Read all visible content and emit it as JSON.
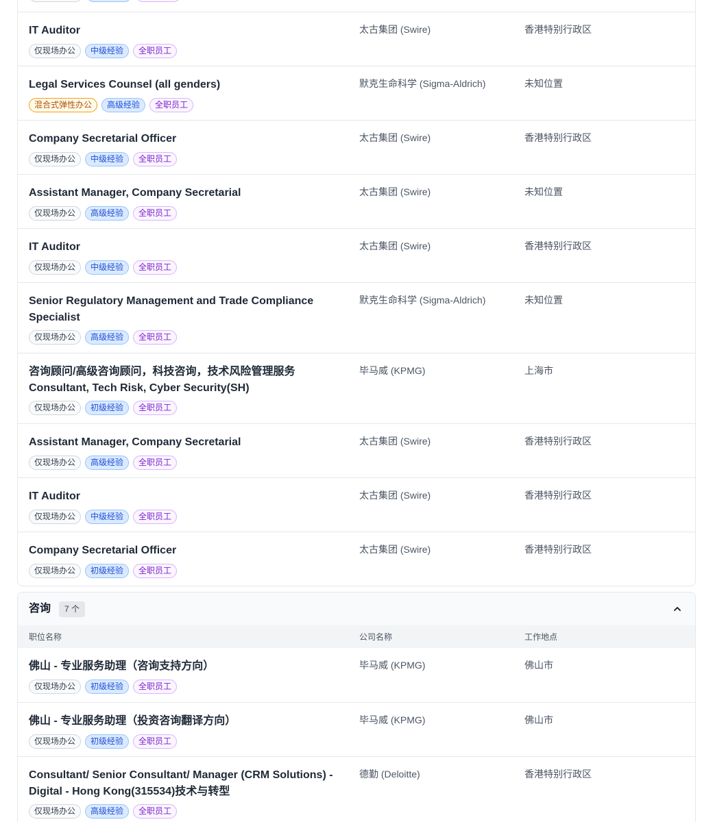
{
  "tag_colors": {
    "gray": "#374151",
    "orange": "#b45309",
    "blue": "#1d4ed8",
    "purple": "#7e22ce"
  },
  "top_group": {
    "rows": [
      {
        "title": "IT Auditor",
        "company": "太古集团 (Swire)",
        "location": "香港特别行政区",
        "tags": [
          {
            "text": "仅现场办公",
            "color": "gray"
          },
          {
            "text": "中级经验",
            "color": "blue"
          },
          {
            "text": "全职员工",
            "color": "purple"
          }
        ]
      },
      {
        "title": "Legal Services Counsel (all genders)",
        "company": "默克生命科学 (Sigma-Aldrich)",
        "location": "未知位置",
        "tags": [
          {
            "text": "混合式弹性办公",
            "color": "orange"
          },
          {
            "text": "高级经验",
            "color": "blue"
          },
          {
            "text": "全职员工",
            "color": "purple"
          }
        ]
      },
      {
        "title": "Company Secretarial Officer",
        "company": "太古集团 (Swire)",
        "location": "香港特别行政区",
        "tags": [
          {
            "text": "仅现场办公",
            "color": "gray"
          },
          {
            "text": "中级经验",
            "color": "blue"
          },
          {
            "text": "全职员工",
            "color": "purple"
          }
        ]
      },
      {
        "title": "Assistant Manager, Company Secretarial",
        "company": "太古集团 (Swire)",
        "location": "未知位置",
        "tags": [
          {
            "text": "仅现场办公",
            "color": "gray"
          },
          {
            "text": "高级经验",
            "color": "blue"
          },
          {
            "text": "全职员工",
            "color": "purple"
          }
        ]
      },
      {
        "title": "IT Auditor",
        "company": "太古集团 (Swire)",
        "location": "香港特别行政区",
        "tags": [
          {
            "text": "仅现场办公",
            "color": "gray"
          },
          {
            "text": "中级经验",
            "color": "blue"
          },
          {
            "text": "全职员工",
            "color": "purple"
          }
        ]
      },
      {
        "title": "Senior Regulatory Management and Trade Compliance Specialist",
        "company": "默克生命科学 (Sigma-Aldrich)",
        "location": "未知位置",
        "tags": [
          {
            "text": "仅现场办公",
            "color": "gray"
          },
          {
            "text": "高级经验",
            "color": "blue"
          },
          {
            "text": "全职员工",
            "color": "purple"
          }
        ]
      },
      {
        "title": "咨询顾问/高级咨询顾问，科技咨询，技术风险管理服务 Consultant, Tech Risk, Cyber Security(SH)",
        "company": "毕马威 (KPMG)",
        "location": "上海市",
        "tags": [
          {
            "text": "仅现场办公",
            "color": "gray"
          },
          {
            "text": "初级经验",
            "color": "blue"
          },
          {
            "text": "全职员工",
            "color": "purple"
          }
        ]
      },
      {
        "title": "Assistant Manager, Company Secretarial",
        "company": "太古集团 (Swire)",
        "location": "香港特别行政区",
        "tags": [
          {
            "text": "仅现场办公",
            "color": "gray"
          },
          {
            "text": "高级经验",
            "color": "blue"
          },
          {
            "text": "全职员工",
            "color": "purple"
          }
        ]
      },
      {
        "title": "IT Auditor",
        "company": "太古集团 (Swire)",
        "location": "香港特别行政区",
        "tags": [
          {
            "text": "仅现场办公",
            "color": "gray"
          },
          {
            "text": "中级经验",
            "color": "blue"
          },
          {
            "text": "全职员工",
            "color": "purple"
          }
        ]
      },
      {
        "title": "Company Secretarial Officer",
        "company": "太古集团 (Swire)",
        "location": "香港特别行政区",
        "tags": [
          {
            "text": "仅现场办公",
            "color": "gray"
          },
          {
            "text": "初级经验",
            "color": "blue"
          },
          {
            "text": "全职员工",
            "color": "purple"
          }
        ]
      }
    ]
  },
  "consulting_group": {
    "title": "咨询",
    "count": "7 个",
    "columns": {
      "title": "职位名称",
      "company": "公司名称",
      "location": "工作地点"
    },
    "rows": [
      {
        "title": "佛山 - 专业服务助理（咨询支持方向）",
        "company": "毕马威 (KPMG)",
        "location": "佛山市",
        "tags": [
          {
            "text": "仅现场办公",
            "color": "gray"
          },
          {
            "text": "初级经验",
            "color": "blue"
          },
          {
            "text": "全职员工",
            "color": "purple"
          }
        ]
      },
      {
        "title": "佛山 - 专业服务助理（投资咨询翻译方向）",
        "company": "毕马威 (KPMG)",
        "location": "佛山市",
        "tags": [
          {
            "text": "仅现场办公",
            "color": "gray"
          },
          {
            "text": "初级经验",
            "color": "blue"
          },
          {
            "text": "全职员工",
            "color": "purple"
          }
        ]
      },
      {
        "title": "Consultant/ Senior Consultant/ Manager (CRM Solutions) - Digital - Hong Kong(315534)技术与转型",
        "company": "德勤 (Deloitte)",
        "location": "香港特别行政区",
        "tags": [
          {
            "text": "仅现场办公",
            "color": "gray"
          },
          {
            "text": "高级经验",
            "color": "blue"
          },
          {
            "text": "全职员工",
            "color": "purple"
          }
        ]
      }
    ]
  }
}
